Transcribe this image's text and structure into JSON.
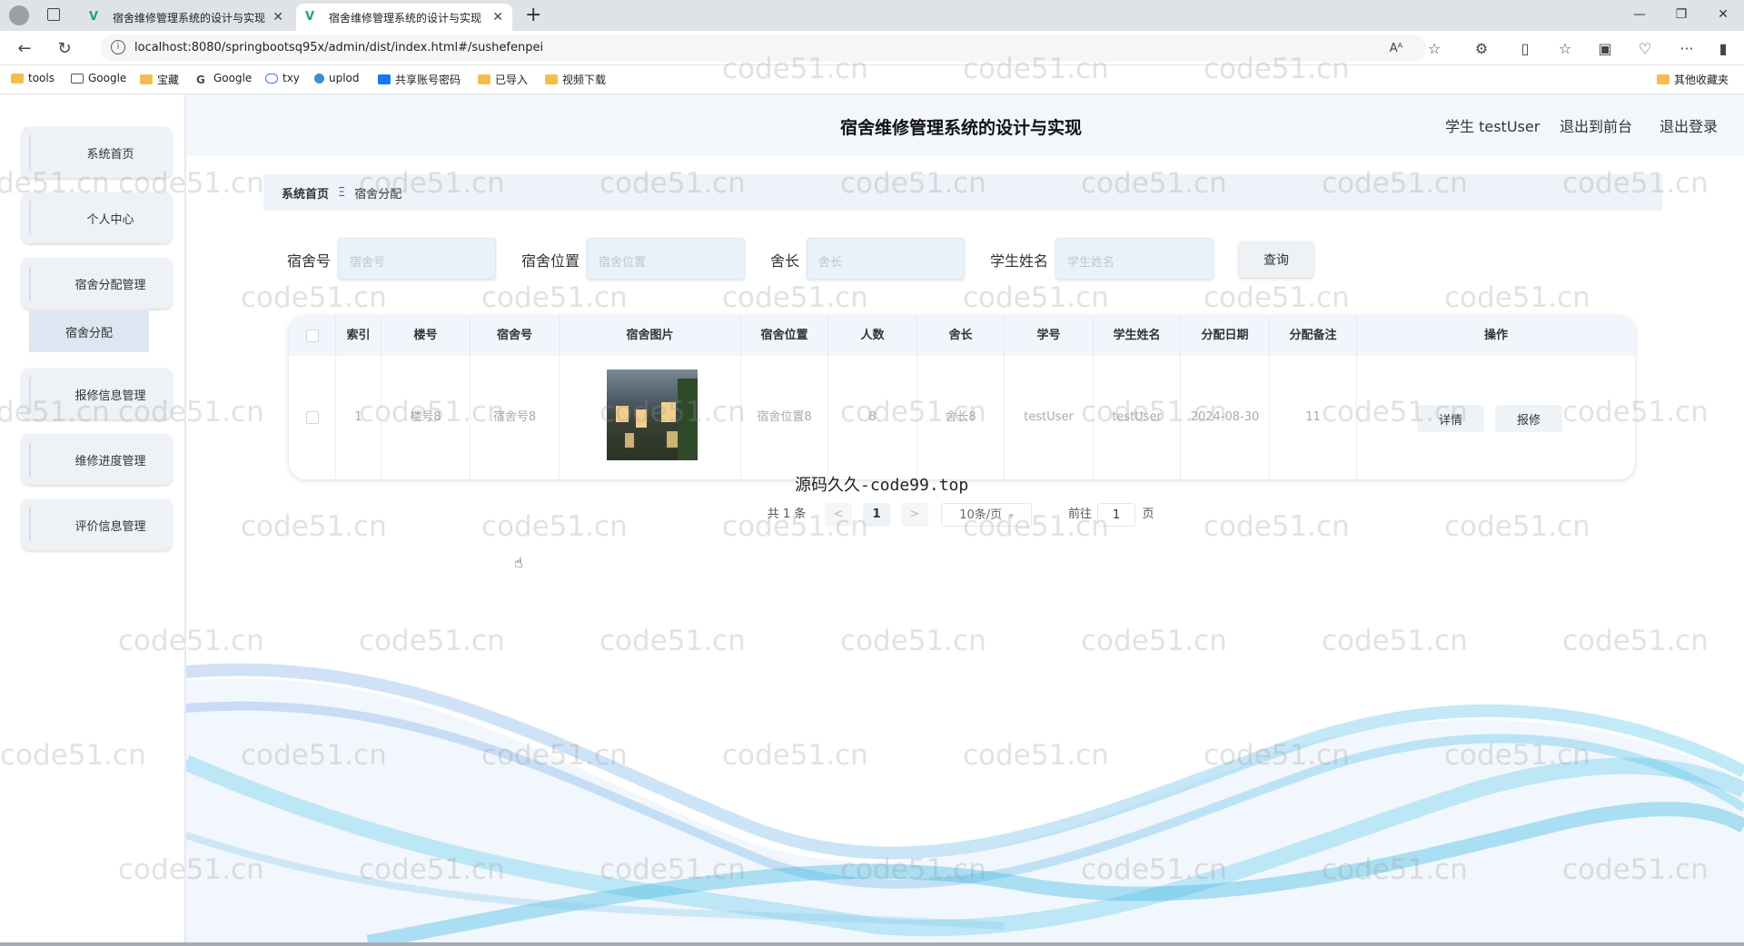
{
  "browser": {
    "tabs": [
      {
        "title": "宿舍维修管理系统的设计与实现"
      },
      {
        "title": "宿舍维修管理系统的设计与实现"
      }
    ],
    "url": "localhost:8080/springbootsq95x/admin/dist/index.html#/sushefenpei",
    "bookmarks": [
      "tools",
      "Google",
      "宝藏",
      "Google",
      "txy",
      "uplod",
      "共享账号密码",
      "已导入",
      "视频下载"
    ],
    "other_bookmarks": "其他收藏夹"
  },
  "header": {
    "title": "宿舍维修管理系统的设计与实现",
    "user": "学生 testUser",
    "back_front": "退出到前台",
    "logout": "退出登录"
  },
  "sidebar": {
    "items": [
      {
        "label": "系统首页"
      },
      {
        "label": "个人中心"
      },
      {
        "label": "宿舍分配管理"
      },
      {
        "label": "报修信息管理"
      },
      {
        "label": "维修进度管理"
      },
      {
        "label": "评价信息管理"
      }
    ],
    "sub_item": "宿舍分配"
  },
  "breadcrumb": {
    "home": "系统首页",
    "sep": "Ξ",
    "current": "宿舍分配"
  },
  "search": {
    "fields": [
      {
        "label": "宿舍号",
        "placeholder": "宿舍号"
      },
      {
        "label": "宿舍位置",
        "placeholder": "宿舍位置"
      },
      {
        "label": "舍长",
        "placeholder": "舍长"
      },
      {
        "label": "学生姓名",
        "placeholder": "学生姓名"
      }
    ],
    "button": "查询"
  },
  "table": {
    "columns": [
      "索引",
      "楼号",
      "宿舍号",
      "宿舍图片",
      "宿舍位置",
      "人数",
      "舍长",
      "学号",
      "学生姓名",
      "分配日期",
      "分配备注",
      "操作"
    ],
    "rows": [
      {
        "index": "1",
        "building": "楼号8",
        "room": "宿舍号8",
        "location": "宿舍位置8",
        "count": "8",
        "leader": "舍长8",
        "student_id": "testUser",
        "student_name": "testUser",
        "date": "2024-08-30",
        "note": "11"
      }
    ],
    "actions": [
      "详情",
      "报修"
    ]
  },
  "overlay_text": "源码久久-code99.top",
  "pagination": {
    "total": "共 1 条",
    "prev": "<",
    "current": "1",
    "next": ">",
    "page_size": "10条/页",
    "goto_label": "前往",
    "goto_value": "1",
    "page_suffix": "页"
  },
  "watermark": "code51.cn"
}
